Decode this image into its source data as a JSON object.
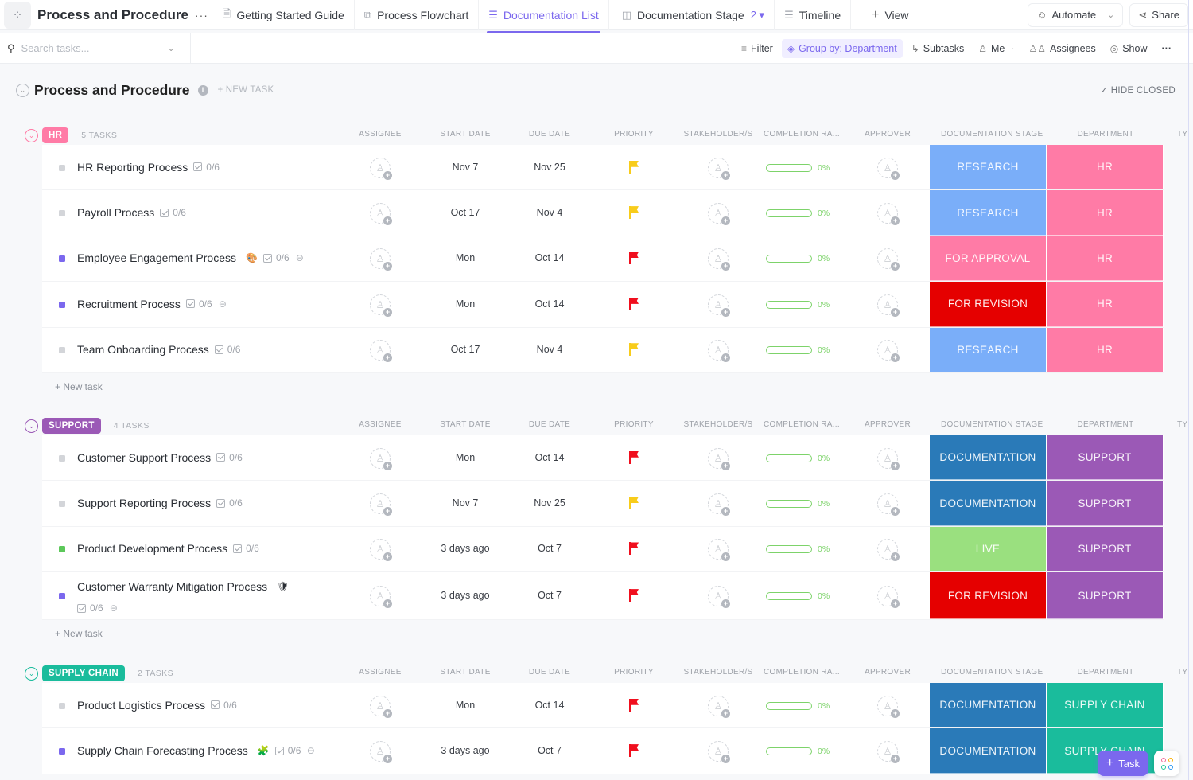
{
  "topbar": {
    "space_title": "Process and Procedure",
    "tabs": [
      {
        "label": "Getting Started Guide",
        "icon": "doc-icon"
      },
      {
        "label": "Process Flowchart",
        "icon": "whiteboard-icon"
      },
      {
        "label": "Documentation List",
        "icon": "list-icon",
        "active": true
      },
      {
        "label": "Documentation Stage",
        "icon": "board-icon",
        "badge": "2"
      },
      {
        "label": "Timeline",
        "icon": "timeline-icon"
      }
    ],
    "add_view": "View",
    "automate": "Automate",
    "share": "Share"
  },
  "toolbar": {
    "search_placeholder": "Search tasks...",
    "filter": "Filter",
    "group_by": "Group by: Department",
    "subtasks": "Subtasks",
    "me": "Me",
    "assignees": "Assignees",
    "show": "Show"
  },
  "list": {
    "title": "Process and Procedure",
    "new_task": "+ NEW TASK",
    "hide_closed": "HIDE CLOSED"
  },
  "columns": {
    "assignee": "ASSIGNEE",
    "start_date": "START DATE",
    "due_date": "DUE DATE",
    "priority": "PRIORITY",
    "stakeholders": "STAKEHOLDER/S",
    "completion": "COMPLETION RA...",
    "approver": "APPROVER",
    "doc_stage": "DOCUMENTATION STAGE",
    "department": "DEPARTMENT",
    "type": "TY"
  },
  "colors": {
    "accent": "#7b68ee",
    "hr": "#ff7ba6",
    "support": "#9b59b6",
    "supply_chain": "#1abc9c",
    "research": "#7aaef9",
    "for_approval": "#ff7ba6",
    "for_revision": "#e50000",
    "documentation": "#2a7ab8",
    "live": "#9ae07f",
    "priority_high": "#f00f1e",
    "priority_normal": "#f8cc1b",
    "progress": "#7dd36a"
  },
  "groups": [
    {
      "name": "HR",
      "count": "5 TASKS",
      "color": "#ff7ba6",
      "new_task": "+ New task",
      "tasks": [
        {
          "name": "HR Reporting Process",
          "status_color": "#d3d5d9",
          "subtasks": "0/6",
          "start": "Nov 7",
          "due": "Nov 25",
          "priority": "normal",
          "completion": 0,
          "completion_label": "0%",
          "stage": "RESEARCH",
          "stage_color": "#7aaef9",
          "department": "HR"
        },
        {
          "name": "Payroll Process",
          "status_color": "#d3d5d9",
          "subtasks": "0/6",
          "start": "Oct 17",
          "due": "Nov 4",
          "priority": "normal",
          "completion": 0,
          "completion_label": "0%",
          "stage": "RESEARCH",
          "stage_color": "#7aaef9",
          "department": "HR"
        },
        {
          "name": "Employee Engagement Process",
          "status_color": "#7b68ee",
          "emoji": "🎨",
          "subtasks": "0/6",
          "attachment": true,
          "start": "Mon",
          "due": "Oct 14",
          "priority": "high",
          "completion": 0,
          "completion_label": "0%",
          "stage": "FOR APPROVAL",
          "stage_color": "#ff7ba6",
          "department": "HR"
        },
        {
          "name": "Recruitment Process",
          "status_color": "#7b68ee",
          "subtasks": "0/6",
          "attachment": true,
          "start": "Mon",
          "due": "Oct 14",
          "priority": "high",
          "completion": 0,
          "completion_label": "0%",
          "stage": "FOR REVISION",
          "stage_color": "#e50000",
          "department": "HR"
        },
        {
          "name": "Team Onboarding Process",
          "status_color": "#d3d5d9",
          "subtasks": "0/6",
          "start": "Oct 17",
          "due": "Nov 4",
          "priority": "normal",
          "completion": 0,
          "completion_label": "0%",
          "stage": "RESEARCH",
          "stage_color": "#7aaef9",
          "department": "HR"
        }
      ]
    },
    {
      "name": "SUPPORT",
      "count": "4 TASKS",
      "color": "#9b59b6",
      "new_task": "+ New task",
      "tasks": [
        {
          "name": "Customer Support Process",
          "status_color": "#d3d5d9",
          "subtasks": "0/6",
          "start": "Mon",
          "due": "Oct 14",
          "priority": "high",
          "completion": 0,
          "completion_label": "0%",
          "stage": "DOCUMENTATION",
          "stage_color": "#2a7ab8",
          "department": "SUPPORT"
        },
        {
          "name": "Support Reporting Process",
          "status_color": "#d3d5d9",
          "subtasks": "0/6",
          "start": "Nov 7",
          "due": "Nov 25",
          "priority": "normal",
          "completion": 0,
          "completion_label": "0%",
          "stage": "DOCUMENTATION",
          "stage_color": "#2a7ab8",
          "department": "SUPPORT"
        },
        {
          "name": "Product Development Process",
          "status_color": "#5cc85a",
          "subtasks": "0/6",
          "start": "3 days ago",
          "due": "Oct 7",
          "priority": "high",
          "completion": 0,
          "completion_label": "0%",
          "stage": "LIVE",
          "stage_color": "#9ae07f",
          "department": "SUPPORT"
        },
        {
          "name": "Customer Warranty Mitigation Process",
          "status_color": "#7b68ee",
          "emoji": "🛡",
          "subtasks": "0/6",
          "attachment": true,
          "wrap": true,
          "start": "3 days ago",
          "due": "Oct 7",
          "priority": "high",
          "completion": 0,
          "completion_label": "0%",
          "stage": "FOR REVISION",
          "stage_color": "#e50000",
          "department": "SUPPORT"
        }
      ]
    },
    {
      "name": "SUPPLY CHAIN",
      "count": "2 TASKS",
      "color": "#1abc9c",
      "tasks": [
        {
          "name": "Product Logistics Process",
          "status_color": "#d3d5d9",
          "subtasks": "0/6",
          "start": "Mon",
          "due": "Oct 14",
          "priority": "high",
          "completion": 0,
          "completion_label": "0%",
          "stage": "DOCUMENTATION",
          "stage_color": "#2a7ab8",
          "department": "SUPPLY CHAIN"
        },
        {
          "name": "Supply Chain Forecasting Process",
          "status_color": "#7b68ee",
          "emoji": "🧩",
          "subtasks": "0/6",
          "attachment": true,
          "start": "3 days ago",
          "due": "Oct 7",
          "priority": "high",
          "completion": 0,
          "completion_label": "0%",
          "stage": "DOCUMENTATION",
          "stage_color": "#2a7ab8",
          "department": "SUPPLY CHAIN"
        }
      ]
    }
  ],
  "fab": {
    "task_label": "Task"
  }
}
